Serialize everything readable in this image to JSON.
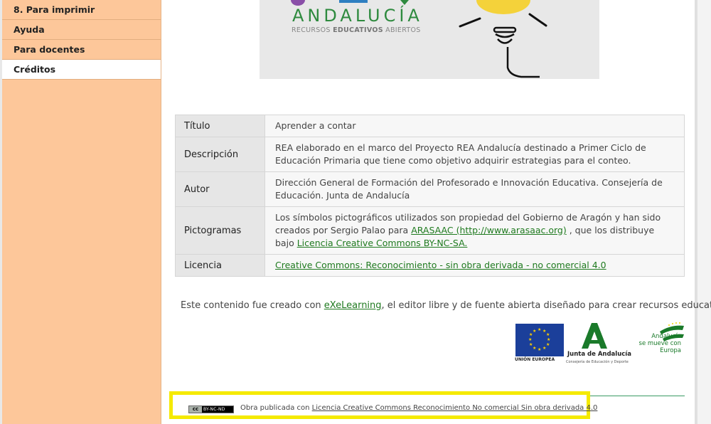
{
  "sidebar": {
    "items": [
      {
        "label": "8. Para imprimir"
      },
      {
        "label": "Ayuda"
      },
      {
        "label": "Para docentes"
      },
      {
        "label": "Créditos",
        "active": true
      }
    ]
  },
  "banner": {
    "brand": "ANDALUCÍA",
    "subtitle_prefix": "RECURSOS ",
    "subtitle_bold": "EDUCATIVOS",
    "subtitle_suffix": " ABIERTOS"
  },
  "credits_table": {
    "rows": [
      {
        "header": "Título",
        "value": "Aprender a contar"
      },
      {
        "header": "Descripción",
        "value": "REA elaborado en el marco del Proyecto REA Andalucía destinado a Primer Ciclo de Educación Primaria que tiene como objetivo adquirir estrategias para el conteo."
      },
      {
        "header": "Autor",
        "value": "Dirección General de Formación del Profesorado e Innovación Educativa. Consejería de Educación. Junta de Andalucía"
      },
      {
        "header": "Pictogramas",
        "text_1": "Los símbolos pictográficos utilizados son propiedad del Gobierno de Aragón y han sido creados por Sergio Palao para ",
        "link_1": "ARASAAC (http://www.arasaac.org)",
        "text_2": " , que los distribuye bajo ",
        "link_2": "Licencia Creative Commons BY-NC-SA."
      },
      {
        "header": "Licencia",
        "link": "Creative Commons: Reconocimiento - sin obra derivada - no comercial 4.0"
      }
    ]
  },
  "exe_notice": {
    "prefix": "Este contenido fue creado con ",
    "link": "eXeLearning",
    "suffix": ", el editor libre y de fuente abierta diseñado para crear recursos educativos."
  },
  "logos": {
    "eu_label": "UNIÓN EUROPEA",
    "junta_label": "Junta de Andalucía",
    "junta_sub": "Consejería de Educación y Deporte",
    "mueve_1": "Andalucía",
    "mueve_2": "se mueve con Europa"
  },
  "footer": {
    "badge_left": "cc",
    "badge_right": "BY-NC-ND",
    "prefix": "Obra publicada con ",
    "link": "Licencia Creative Commons Reconocimiento No comercial Sin obra derivada 4.0"
  },
  "colors": {
    "sidebar_bg": "#fdc79a",
    "link_green": "#1f7a1f",
    "highlight_yellow": "#f5ea00"
  }
}
